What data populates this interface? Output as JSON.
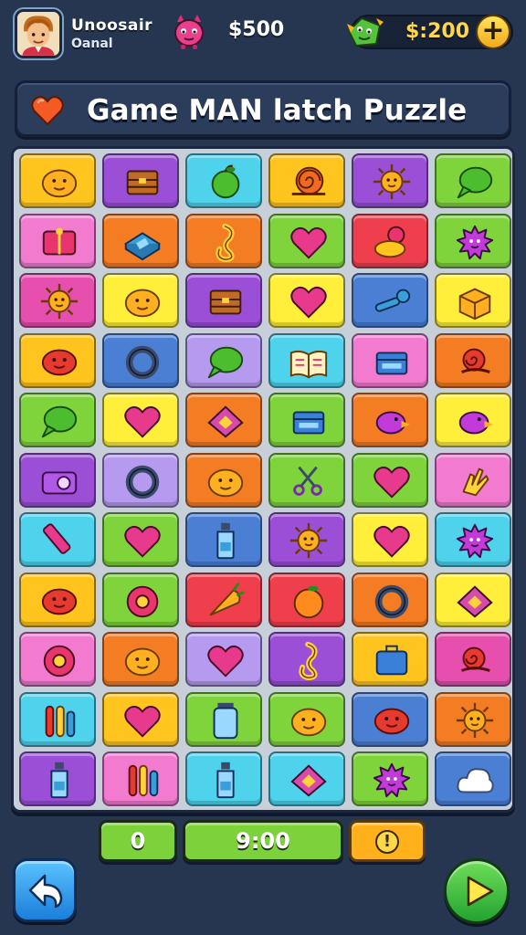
{
  "player": {
    "name": "Unoosair",
    "subtitle": "Oanal"
  },
  "currency": {
    "coins": "$500",
    "gems": "$:200",
    "add_label": "+"
  },
  "title": "Game MAN latch Puzzle",
  "colors": {
    "yellow": "#ffc51e",
    "purple": "#9b4fd6",
    "cyan": "#4fd3ec",
    "green": "#7fd43b",
    "pink": "#f27bd0",
    "orange": "#f47c22",
    "red": "#ef3f4c",
    "blue": "#4a7fd4",
    "lime": "#ffef3a",
    "magenta": "#e64fae",
    "lavender": "#b59af0"
  },
  "board": {
    "rows": [
      [
        {
          "color": "yellow",
          "icon": "blob-face-icon"
        },
        {
          "color": "purple",
          "icon": "treasure-chest-icon"
        },
        {
          "color": "cyan",
          "icon": "green-apple-icon"
        },
        {
          "color": "yellow",
          "icon": "spiral-snail-icon"
        },
        {
          "color": "purple",
          "icon": "sun-face-icon"
        },
        {
          "color": "green",
          "icon": "speech-bubble-icon"
        }
      ],
      [
        {
          "color": "pink",
          "icon": "gift-box-icon"
        },
        {
          "color": "orange",
          "icon": "book-icon"
        },
        {
          "color": "orange",
          "icon": "swirl-icon"
        },
        {
          "color": "green",
          "icon": "heart-icon"
        },
        {
          "color": "red",
          "icon": "duck-icon"
        },
        {
          "color": "green",
          "icon": "spiky-monster-icon"
        }
      ],
      [
        {
          "color": "magenta",
          "icon": "sun-face-icon"
        },
        {
          "color": "lime",
          "icon": "blob-face-icon"
        },
        {
          "color": "purple",
          "icon": "treasure-chest-icon"
        },
        {
          "color": "lime",
          "icon": "heart-icon"
        },
        {
          "color": "blue",
          "icon": "key-icon"
        },
        {
          "color": "lime",
          "icon": "box-icon"
        }
      ],
      [
        {
          "color": "yellow",
          "icon": "red-blob-icon"
        },
        {
          "color": "blue",
          "icon": "ring-icon"
        },
        {
          "color": "lavender",
          "icon": "speech-bubble-icon"
        },
        {
          "color": "cyan",
          "icon": "open-book-icon"
        },
        {
          "color": "pink",
          "icon": "crate-icon"
        },
        {
          "color": "orange",
          "icon": "snail-icon"
        }
      ],
      [
        {
          "color": "green",
          "icon": "speech-bubble-icon"
        },
        {
          "color": "lime",
          "icon": "heart-icon"
        },
        {
          "color": "orange",
          "icon": "diamond-tile-icon"
        },
        {
          "color": "green",
          "icon": "crate-icon"
        },
        {
          "color": "orange",
          "icon": "bird-icon"
        },
        {
          "color": "lime",
          "icon": "bird-icon"
        }
      ],
      [
        {
          "color": "purple",
          "icon": "camera-icon"
        },
        {
          "color": "lavender",
          "icon": "ring-icon"
        },
        {
          "color": "orange",
          "icon": "blob-face-icon"
        },
        {
          "color": "green",
          "icon": "scissors-icon"
        },
        {
          "color": "green",
          "icon": "heart-icon"
        },
        {
          "color": "pink",
          "icon": "hand-icon"
        }
      ],
      [
        {
          "color": "cyan",
          "icon": "pencil-icon"
        },
        {
          "color": "green",
          "icon": "heart-icon"
        },
        {
          "color": "blue",
          "icon": "bottle-icon"
        },
        {
          "color": "purple",
          "icon": "sun-face-icon"
        },
        {
          "color": "lime",
          "icon": "heart-icon"
        },
        {
          "color": "cyan",
          "icon": "spiky-monster-icon"
        }
      ],
      [
        {
          "color": "yellow",
          "icon": "red-blob-icon"
        },
        {
          "color": "green",
          "icon": "donut-icon"
        },
        {
          "color": "red",
          "icon": "carrot-icon"
        },
        {
          "color": "red",
          "icon": "orange-fruit-icon"
        },
        {
          "color": "orange",
          "icon": "ring-icon"
        },
        {
          "color": "lime",
          "icon": "diamond-tile-icon"
        }
      ],
      [
        {
          "color": "pink",
          "icon": "donut-icon"
        },
        {
          "color": "orange",
          "icon": "blob-face-icon"
        },
        {
          "color": "lavender",
          "icon": "heart-icon"
        },
        {
          "color": "purple",
          "icon": "swirl-icon"
        },
        {
          "color": "yellow",
          "icon": "suitcase-icon"
        },
        {
          "color": "magenta",
          "icon": "snail-icon"
        }
      ],
      [
        {
          "color": "cyan",
          "icon": "test-tubes-icon"
        },
        {
          "color": "yellow",
          "icon": "heart-icon"
        },
        {
          "color": "green",
          "icon": "jar-icon"
        },
        {
          "color": "green",
          "icon": "blob-face-icon"
        },
        {
          "color": "blue",
          "icon": "red-blob-icon"
        },
        {
          "color": "orange",
          "icon": "sun-face-icon"
        }
      ],
      [
        {
          "color": "purple",
          "icon": "bottle-icon"
        },
        {
          "color": "pink",
          "icon": "test-tubes-icon"
        },
        {
          "color": "cyan",
          "icon": "bottle-icon"
        },
        {
          "color": "cyan",
          "icon": "diamond-tile-icon"
        },
        {
          "color": "green",
          "icon": "spiky-monster-icon"
        },
        {
          "color": "blue",
          "icon": "cloud-icon"
        }
      ]
    ]
  },
  "hud": {
    "score": "0",
    "timer": "9:00",
    "hint": "!"
  },
  "buttons": {
    "back_icon": "back-arrow-icon",
    "play_icon": "play-icon"
  }
}
